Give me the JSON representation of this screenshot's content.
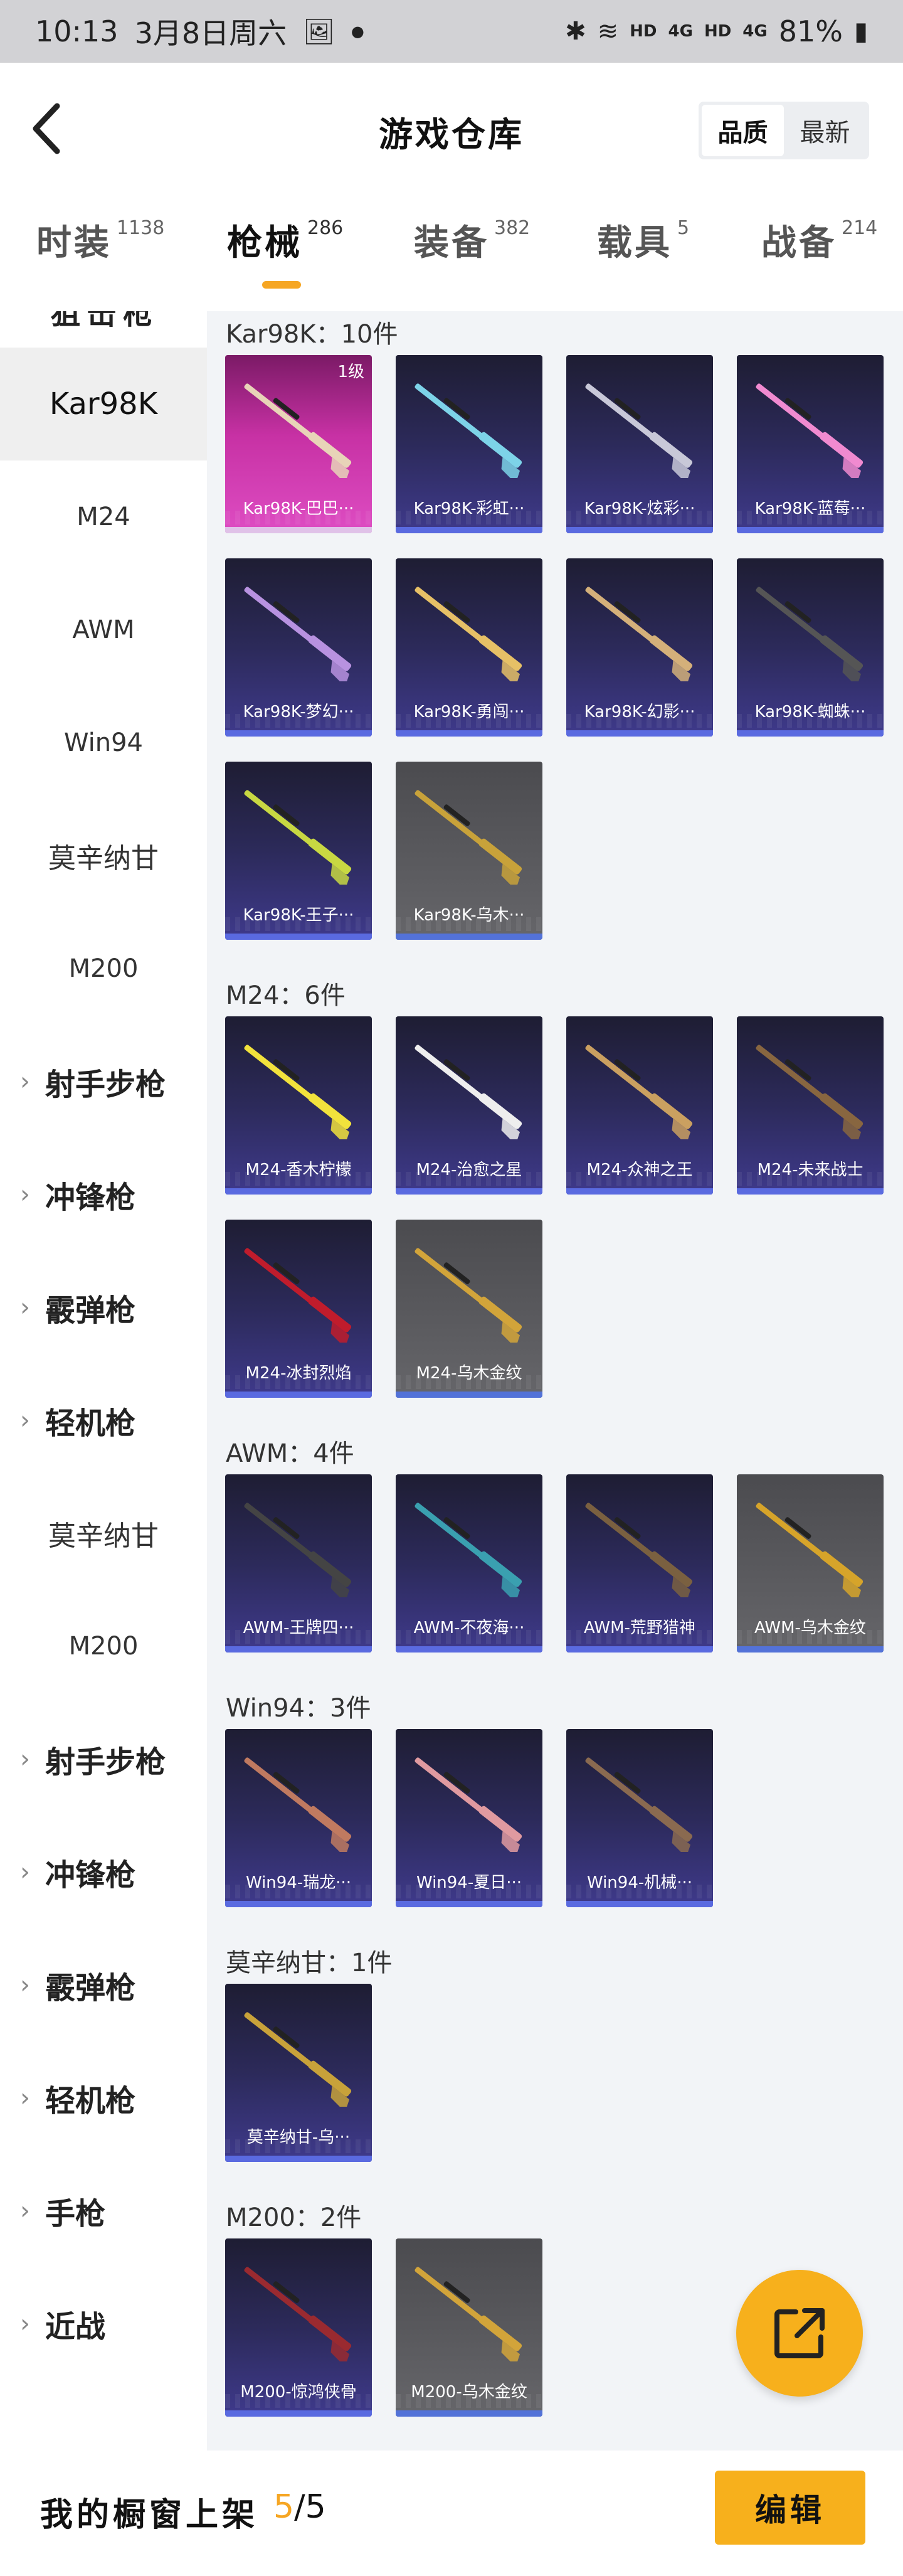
{
  "status_bar": {
    "time": "10:13",
    "date": "3月8日周六",
    "battery": "81%",
    "net1": "HD",
    "net2": "4G",
    "net3": "HD",
    "net4": "4G"
  },
  "header": {
    "title": "游戏仓库",
    "sort_options": [
      "品质",
      "最新"
    ]
  },
  "category_tabs": [
    {
      "label": "时装",
      "count": "1138"
    },
    {
      "label": "枪械",
      "count": "286"
    },
    {
      "label": "装备",
      "count": "382"
    },
    {
      "label": "载具",
      "count": "5"
    },
    {
      "label": "战备",
      "count": "214"
    }
  ],
  "sidebar": {
    "cut_top_label": "狙击枪",
    "items": [
      "Kar98K",
      "M24",
      "AWM",
      "Win94",
      "莫辛纳甘",
      "M200",
      "射手步枪",
      "冲锋枪",
      "霰弹枪",
      "轻机枪",
      "莫辛纳甘",
      "M200",
      "射手步枪",
      "冲锋枪",
      "霰弹枪",
      "轻机枪",
      "手枪",
      "近战"
    ]
  },
  "sections": [
    {
      "title": "Kar98K：10件",
      "items": [
        {
          "name": "Kar98K-巴巴···",
          "level": "1级"
        },
        {
          "name": "Kar98K-彩虹···"
        },
        {
          "name": "Kar98K-炫彩···"
        },
        {
          "name": "Kar98K-蓝莓···"
        },
        {
          "name": "Kar98K-梦幻···"
        },
        {
          "name": "Kar98K-勇闯···"
        },
        {
          "name": "Kar98K-幻影···"
        },
        {
          "name": "Kar98K-蜘蛛···"
        },
        {
          "name": "Kar98K-王子···"
        },
        {
          "name": "Kar98K-乌木···"
        }
      ]
    },
    {
      "title": "M24：6件",
      "items": [
        {
          "name": "M24-香木柠檬"
        },
        {
          "name": "M24-治愈之星"
        },
        {
          "name": "M24-众神之王"
        },
        {
          "name": "M24-未来战士"
        },
        {
          "name": "M24-冰封烈焰"
        },
        {
          "name": "M24-乌木金纹"
        }
      ]
    },
    {
      "title": "AWM：4件",
      "items": [
        {
          "name": "AWM-王牌四···"
        },
        {
          "name": "AWM-不夜海···"
        },
        {
          "name": "AWM-荒野猎神"
        },
        {
          "name": "AWM-乌木金纹"
        }
      ]
    },
    {
      "title": "Win94：3件",
      "items": [
        {
          "name": "Win94-瑞龙···"
        },
        {
          "name": "Win94-夏日···"
        },
        {
          "name": "Win94-机械···"
        }
      ]
    },
    {
      "title": "莫辛纳甘：1件",
      "items": [
        {
          "name": "莫辛纳甘-乌···"
        }
      ]
    },
    {
      "title": "M200：2件",
      "items": [
        {
          "name": "M200-惊鸿侠骨"
        },
        {
          "name": "M200-乌木金纹"
        }
      ]
    }
  ],
  "bottom_bar": {
    "label": "我的橱窗上架",
    "count_current": "5",
    "count_total": "/5",
    "edit_label": "编辑"
  },
  "colors": {
    "accent": "#f7b01c",
    "tab_underline": "#f6a623",
    "card_purple": "#3f3a8c",
    "card_gold": "#5b5b5f",
    "card_pink": "#c731a4"
  },
  "icons": {
    "back": "chevron-left-icon",
    "share": "share-external-icon"
  }
}
